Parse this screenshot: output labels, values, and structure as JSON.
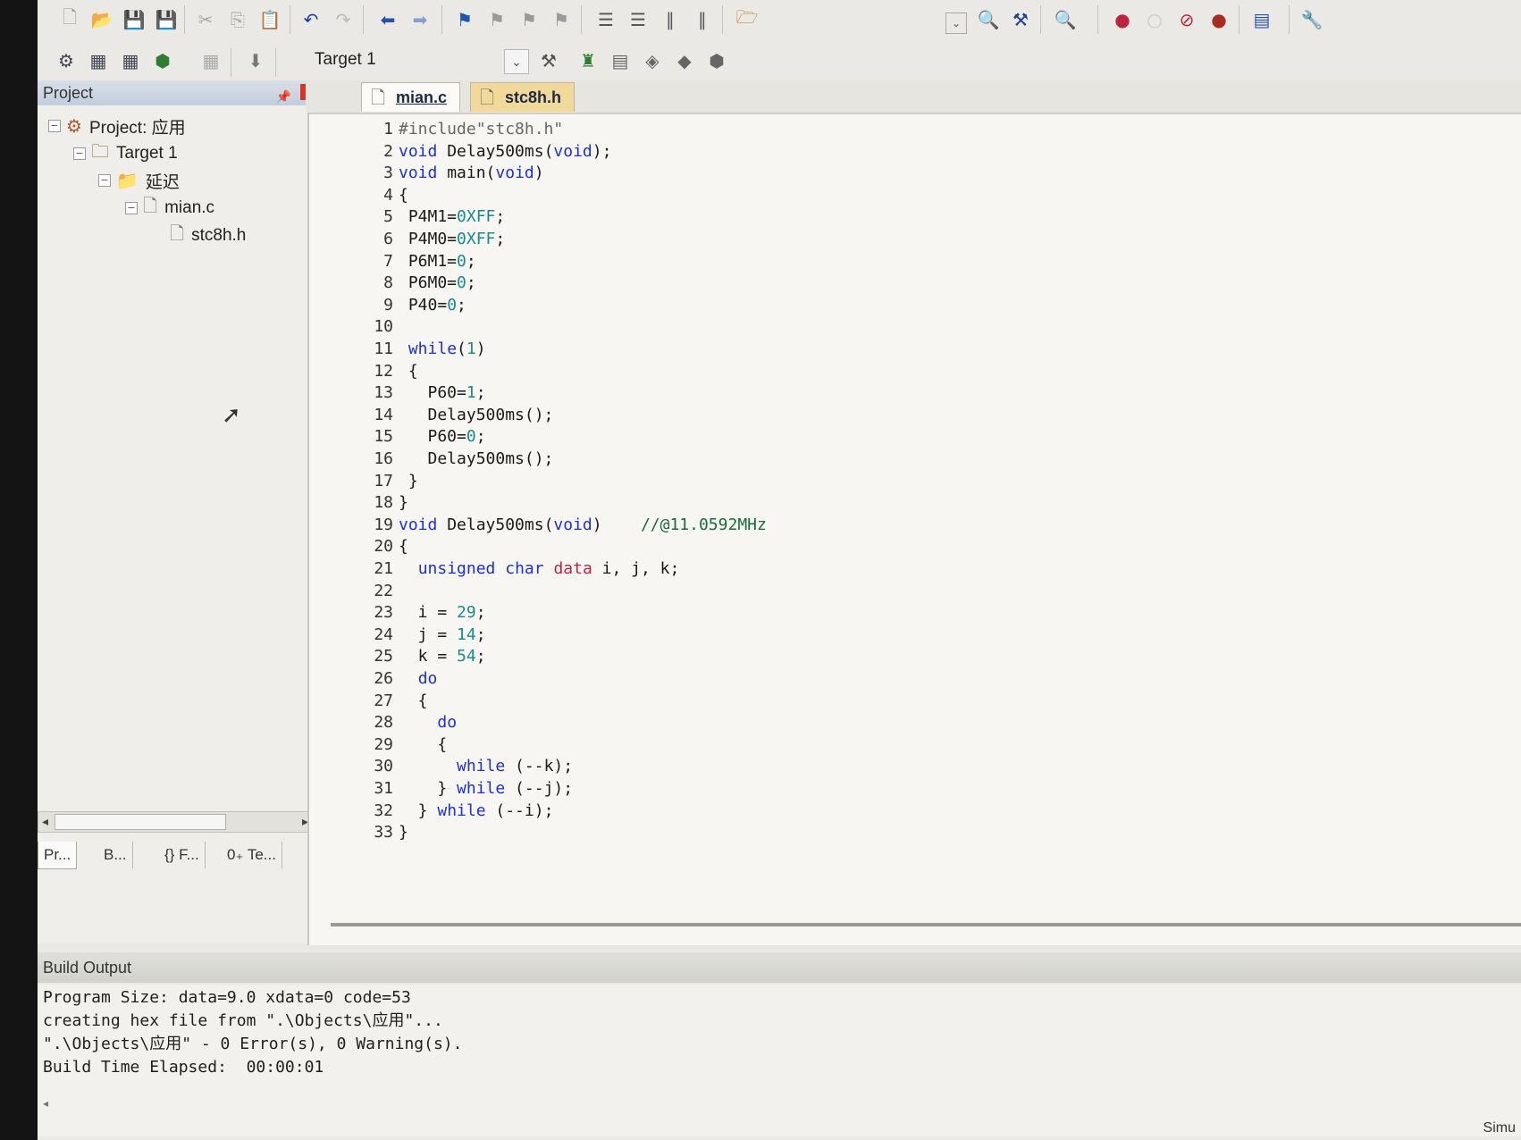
{
  "toolbar1": {
    "icons": [
      "new-file-icon",
      "open-icon",
      "save-icon",
      "save-all-icon",
      "cut-icon",
      "copy-icon",
      "paste-icon",
      "undo-icon",
      "redo-icon",
      "nav-back-icon",
      "nav-forward-icon",
      "bookmark-icon",
      "bookmark-prev-icon",
      "bookmark-next-icon",
      "bookmark-clear-icon",
      "indent-icon",
      "unindent-icon",
      "comment-icon",
      "uncomment-icon",
      "find-in-files-icon",
      "find-combo-icon",
      "incremental-find-icon",
      "debug-session-icon",
      "breakpoint-insert-icon",
      "breakpoint-disable-icon",
      "breakpoint-kill-icon",
      "window-layout-icon",
      "config-wrench-icon"
    ]
  },
  "toolbar2": {
    "target_label": "Target 1",
    "icons": [
      "translate-icon",
      "build-icon",
      "rebuild-icon",
      "batch-build-icon",
      "stop-build-icon",
      "download-load-icon",
      "options-icon",
      "manage-project-icon",
      "component-icon",
      "pack-installer-icon",
      "select-packs-icon"
    ]
  },
  "project_panel": {
    "title": "Project",
    "tree": [
      {
        "label": "Project: 应用",
        "icon": "project-icon"
      },
      {
        "label": "Target 1",
        "icon": "target-icon"
      },
      {
        "label": "延迟",
        "icon": "folder-icon"
      },
      {
        "label": "mian.c",
        "icon": "file-icon"
      },
      {
        "label": "stc8h.h",
        "icon": "file-icon"
      }
    ],
    "tabs": [
      "Pr...",
      "B...",
      "{} F...",
      "0₊ Te..."
    ]
  },
  "editor": {
    "tabs": [
      {
        "label": "mian.c",
        "active": true
      },
      {
        "label": "stc8h.h",
        "active": false
      }
    ],
    "lines": [
      {
        "n": "1",
        "html": "<span class='pp'>#include\"stc8h.h\"</span>"
      },
      {
        "n": "2",
        "html": "<span class='kw'>void</span> Delay500ms(<span class='kw'>void</span>);"
      },
      {
        "n": "3",
        "html": "<span class='kw'>void</span> main(<span class='kw'>void</span>)"
      },
      {
        "n": "4",
        "html": "{"
      },
      {
        "n": "5",
        "html": " P4M1=<span class='num'>0XFF</span>;"
      },
      {
        "n": "6",
        "html": " P4M0=<span class='num'>0XFF</span>;"
      },
      {
        "n": "7",
        "html": " P6M1=<span class='num'>0</span>;"
      },
      {
        "n": "8",
        "html": " P6M0=<span class='num'>0</span>;"
      },
      {
        "n": "9",
        "html": " P40=<span class='num'>0</span>;"
      },
      {
        "n": "10",
        "html": ""
      },
      {
        "n": "11",
        "html": " <span class='kw'>while</span>(<span class='num'>1</span>)"
      },
      {
        "n": "12",
        "html": " {"
      },
      {
        "n": "13",
        "html": "   P60=<span class='num'>1</span>;"
      },
      {
        "n": "14",
        "html": "   Delay500ms();"
      },
      {
        "n": "15",
        "html": "   P60=<span class='num'>0</span>;"
      },
      {
        "n": "16",
        "html": "   Delay500ms();"
      },
      {
        "n": "17",
        "html": " }"
      },
      {
        "n": "18",
        "html": "}"
      },
      {
        "n": "19",
        "html": "<span class='kw'>void</span> Delay500ms(<span class='kw'>void</span>)    <span class='cmt'>//@11.0592MHz</span>"
      },
      {
        "n": "20",
        "html": "{"
      },
      {
        "n": "21",
        "html": "  <span class='kw'>unsigned</span> <span class='kw'>char</span> <span class='ty'>data</span> i, j, k;"
      },
      {
        "n": "22",
        "html": ""
      },
      {
        "n": "23",
        "html": "  i = <span class='num'>29</span>;"
      },
      {
        "n": "24",
        "html": "  j = <span class='num'>14</span>;"
      },
      {
        "n": "25",
        "html": "  k = <span class='num'>54</span>;"
      },
      {
        "n": "26",
        "html": "  <span class='kw'>do</span>"
      },
      {
        "n": "27",
        "html": "  {"
      },
      {
        "n": "28",
        "html": "    <span class='kw'>do</span>"
      },
      {
        "n": "29",
        "html": "    {"
      },
      {
        "n": "30",
        "html": "      <span class='kw'>while</span> (--k);"
      },
      {
        "n": "31",
        "html": "    } <span class='kw'>while</span> (--j);"
      },
      {
        "n": "32",
        "html": "  } <span class='kw'>while</span> (--i);"
      },
      {
        "n": "33",
        "html": "}"
      }
    ]
  },
  "build_output": {
    "title": "Build Output",
    "lines": [
      "Program Size: data=9.0 xdata=0 code=53",
      "creating hex file from \".\\Objects\\应用\"...",
      "\".\\Objects\\应用\" - 0 Error(s), 0 Warning(s).",
      "Build Time Elapsed:  00:00:01"
    ]
  },
  "status": {
    "mode": "Simu"
  }
}
